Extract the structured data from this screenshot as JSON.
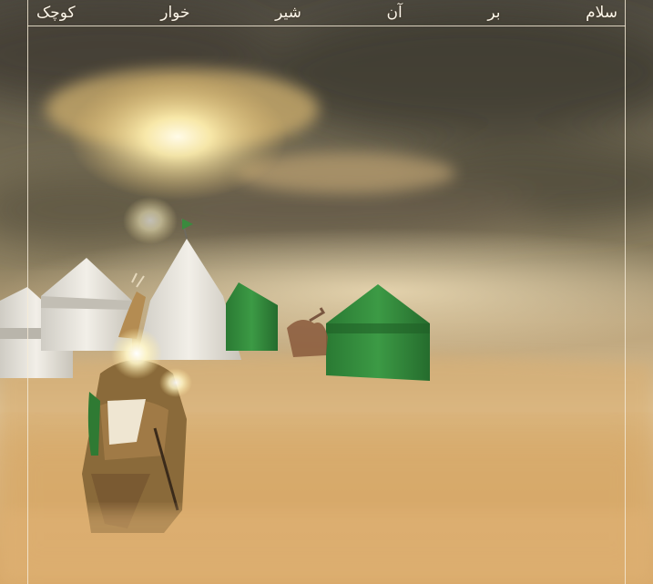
{
  "poster": {
    "title_words": [
      "سلام",
      "بر",
      "آن",
      "شیر",
      "خوار",
      "کوچک"
    ]
  },
  "colors": {
    "sky_dark": "#5b5546",
    "sand": "#d9b27a",
    "tent_green": "#2f8a3a",
    "tent_white": "#e9e6df",
    "frame": "#f4ead6"
  }
}
